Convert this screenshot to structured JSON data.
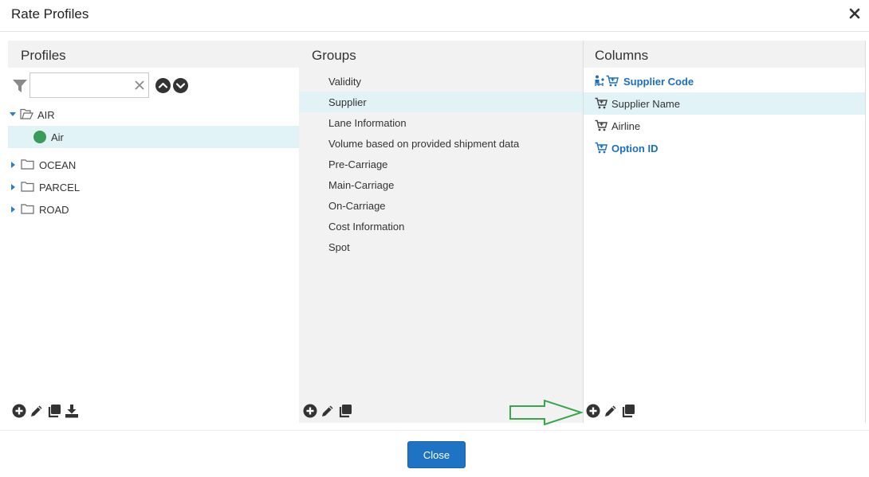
{
  "dialog": {
    "title": "Rate Profiles",
    "close_icon": "close-icon"
  },
  "profiles": {
    "heading": "Profiles",
    "search": {
      "value": "",
      "placeholder": ""
    },
    "tree": [
      {
        "label": "AIR",
        "expanded": true,
        "icon": "folder-open-icon"
      },
      {
        "label": "Air",
        "selected": true,
        "status_color": "#3b9b5b"
      },
      {
        "label": "OCEAN",
        "expanded": false,
        "icon": "folder-icon"
      },
      {
        "label": "PARCEL",
        "expanded": false,
        "icon": "folder-icon"
      },
      {
        "label": "ROAD",
        "expanded": false,
        "icon": "folder-icon"
      }
    ],
    "tools": [
      "add-icon",
      "edit-icon",
      "copy-icon",
      "download-icon"
    ]
  },
  "groups": {
    "heading": "Groups",
    "items": [
      "Validity",
      "Supplier",
      "Lane Information",
      "Volume based on provided shipment data",
      "Pre-Carriage",
      "Main-Carriage",
      "On-Carriage",
      "Cost Information",
      "Spot"
    ],
    "selected_index": 1,
    "tools": [
      "add-icon",
      "edit-icon",
      "copy-icon"
    ]
  },
  "columns": {
    "heading": "Columns",
    "items": [
      {
        "label": "Supplier Code",
        "bold": true,
        "icons": [
          "hierarchy-icon",
          "cart-icon"
        ]
      },
      {
        "label": "Supplier Name",
        "bold": false,
        "selected": true,
        "icons": [
          "cart-icon"
        ]
      },
      {
        "label": "Airline",
        "bold": false,
        "icons": [
          "cart-icon"
        ]
      },
      {
        "label": "Option ID",
        "bold": true,
        "icons": [
          "cart-icon"
        ]
      }
    ],
    "tools": [
      "add-icon",
      "edit-icon",
      "copy-icon"
    ]
  },
  "footer": {
    "close_label": "Close"
  },
  "colors": {
    "accent": "#1f73c4",
    "link": "#1a6fc1",
    "selection": "#e1f3f6",
    "status_green": "#3b9b5b",
    "annotation_arrow": "#3aa64a"
  }
}
